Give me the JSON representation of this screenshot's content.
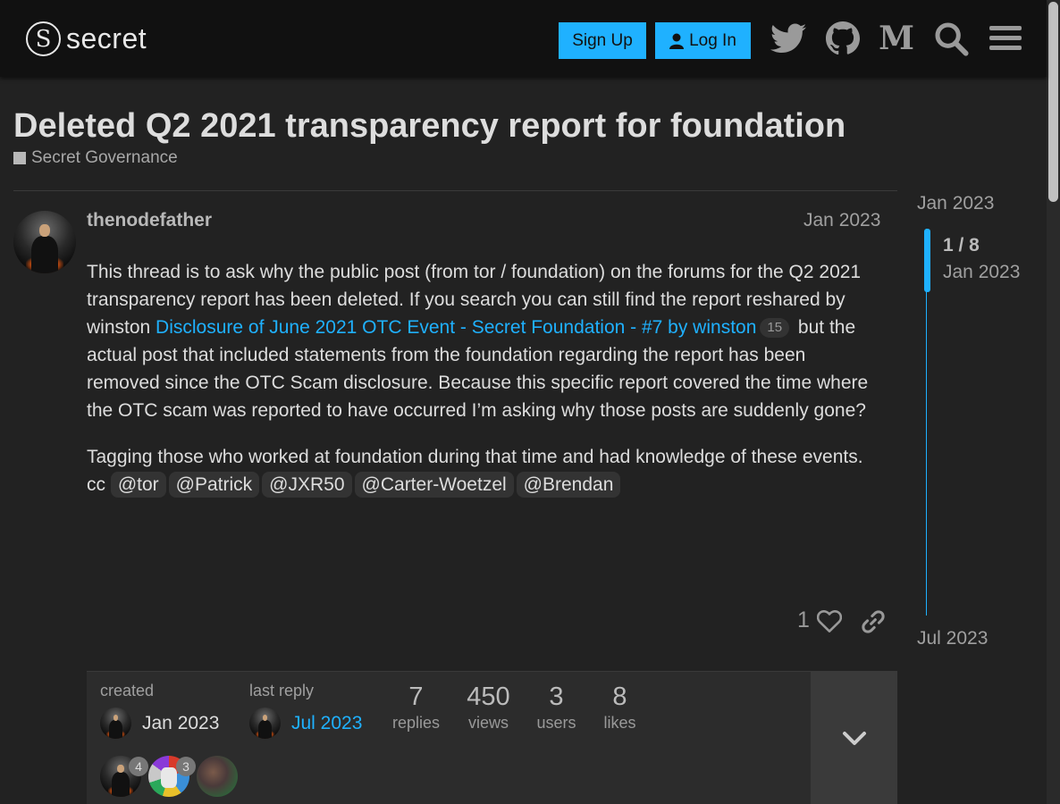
{
  "header": {
    "logo_glyph": "S",
    "logo_text": "secret",
    "signup_label": "Sign Up",
    "login_label": "Log In",
    "icons": [
      "twitter-icon",
      "github-icon",
      "medium-icon",
      "search-icon",
      "hamburger-menu-icon"
    ],
    "medium_glyph": "M"
  },
  "topic": {
    "title": "Deleted Q2 2021 transparency report for foundation",
    "category": "Secret Governance"
  },
  "post": {
    "username": "thenodefather",
    "date": "Jan 2023",
    "para1_text1": "This thread is to ask why the public post (from tor / foundation) on the forums for the Q2 2021 transparency report has been deleted. If you search you can still find the report reshared by winston ",
    "para1_link": "Disclosure of June 2021 OTC Event - Secret Foundation - #7 by winston",
    "para1_link_count": "15",
    "para1_text2": " but the actual post that included statements from the foundation regarding the report has been removed since the OTC Scam disclosure. Because this specific report covered the time where the OTC scam was reported to have occurred I’m asking why those posts are suddenly gone?",
    "para2": "Tagging those who worked at foundation during that time and had knowledge of these events.",
    "cc": "cc",
    "mentions": [
      "@tor",
      "@Patrick",
      "@JXR50",
      "@Carter-Woetzel",
      "@Brendan"
    ],
    "like_count": "1"
  },
  "topic_map": {
    "created_label": "created",
    "created_date": "Jan 2023",
    "last_reply_label": "last reply",
    "last_reply_date": "Jul 2023",
    "stats": [
      {
        "num": "7",
        "label": "replies"
      },
      {
        "num": "450",
        "label": "views"
      },
      {
        "num": "3",
        "label": "users"
      },
      {
        "num": "8",
        "label": "likes"
      }
    ],
    "participant_counts": [
      "4",
      "3"
    ]
  },
  "timeline": {
    "top_date": "Jan 2023",
    "count": "1 / 8",
    "handle_date": "Jan 2023",
    "bottom_date": "Jul 2023"
  },
  "colors": {
    "accent": "#1fb1ff",
    "background": "#222222",
    "header": "#111111"
  }
}
